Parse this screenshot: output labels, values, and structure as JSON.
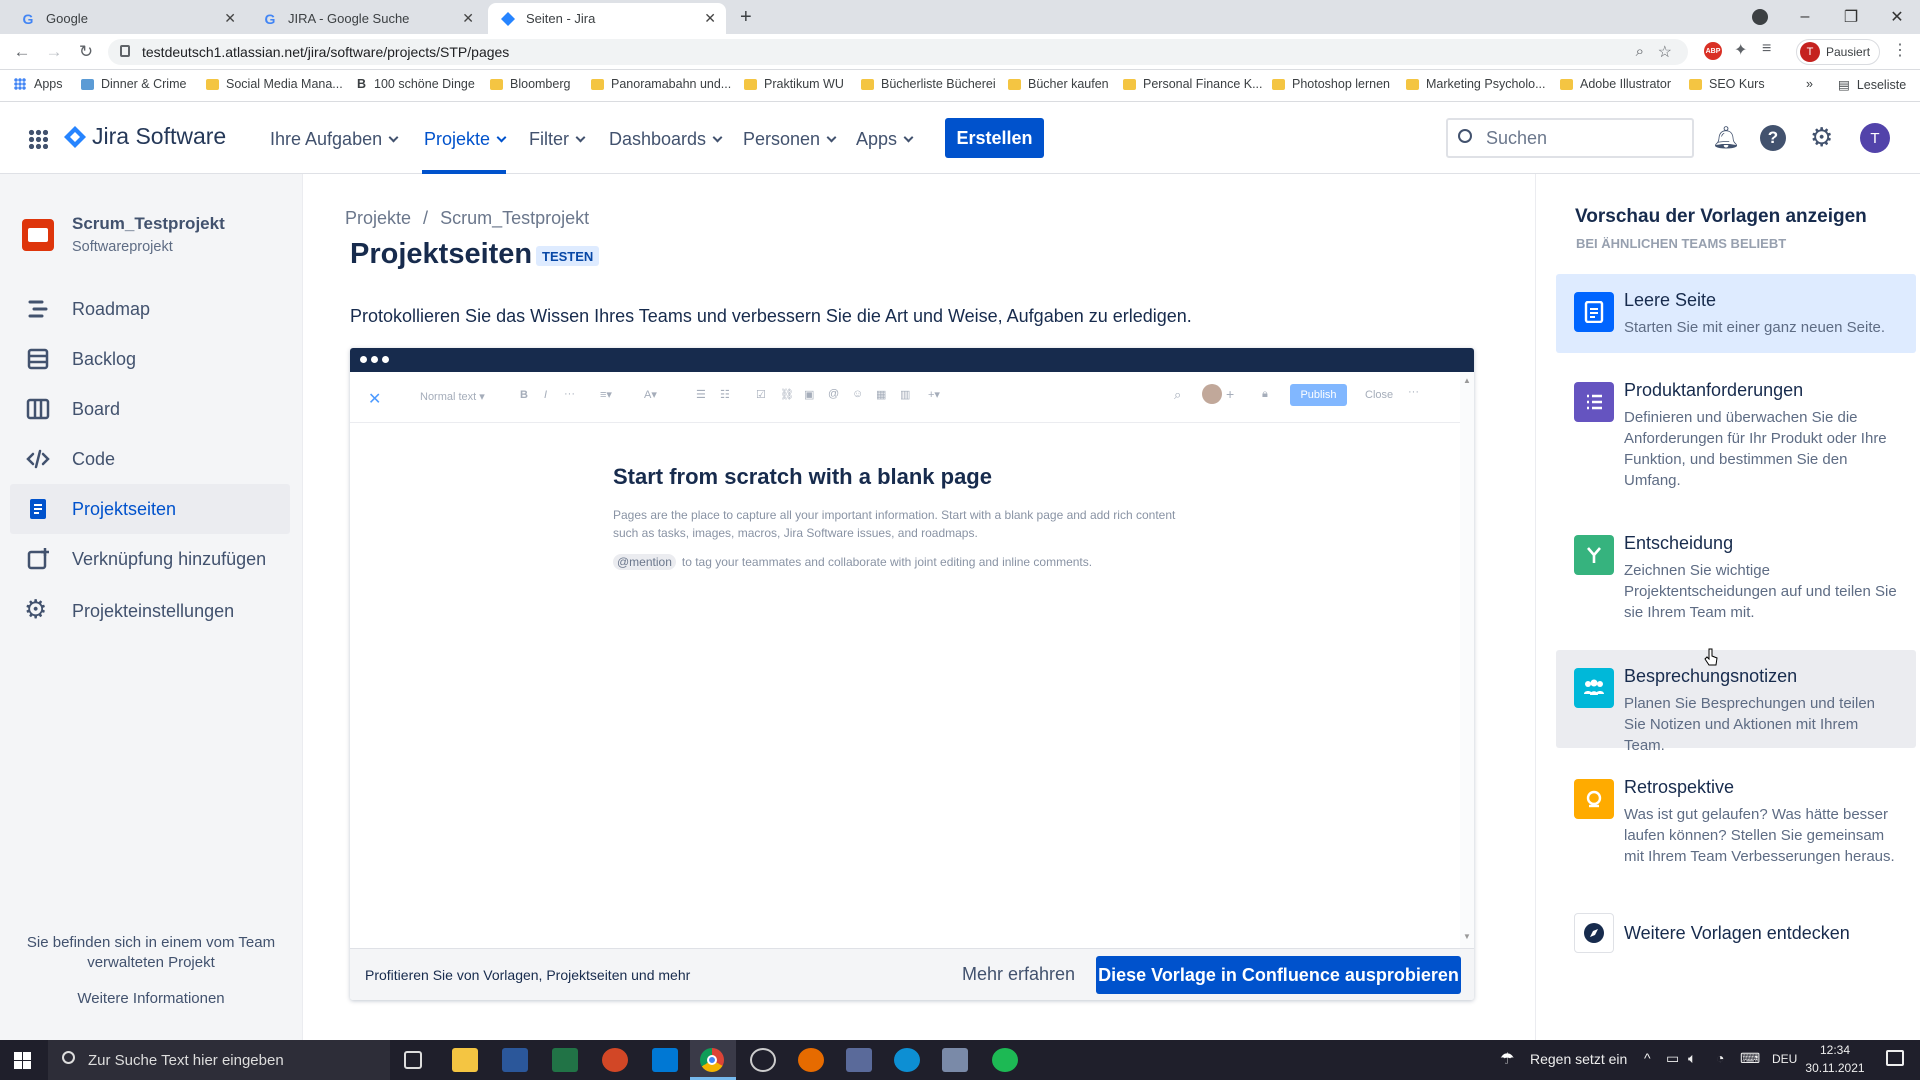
{
  "browser": {
    "tabs": [
      {
        "title": "Google",
        "icon": "google-icon"
      },
      {
        "title": "JIRA - Google Suche",
        "icon": "google-icon"
      },
      {
        "title": "Seiten - Jira",
        "icon": "jira-icon"
      }
    ],
    "url": "testdeutsch1.atlassian.net/jira/software/projects/STP/pages",
    "profile_status": "Pausiert",
    "profile_initial": "T",
    "bookmarks": [
      "Apps",
      "Dinner & Crime",
      "Social Media Mana...",
      "100 schöne Dinge",
      "Bloomberg",
      "Panoramabahn und...",
      "Praktikum WU",
      "Bücherliste Bücherei",
      "Bücher kaufen",
      "Personal Finance K...",
      "Photoshop lernen",
      "Marketing Psycholo...",
      "Adobe Illustrator",
      "SEO Kurs"
    ],
    "reading_list": "Leseliste"
  },
  "jira": {
    "product": "Jira Software",
    "menu": [
      "Ihre Aufgaben",
      "Projekte",
      "Filter",
      "Dashboards",
      "Personen",
      "Apps"
    ],
    "create_label": "Erstellen",
    "search_placeholder": "Suchen",
    "avatar_initial": "T",
    "accent": "#0052cc"
  },
  "sidebar": {
    "project_name": "Scrum_Testprojekt",
    "project_type": "Softwareprojekt",
    "items": [
      "Roadmap",
      "Backlog",
      "Board",
      "Code",
      "Projektseiten",
      "Verknüpfung hinzufügen",
      "Projekteinstellungen"
    ],
    "selected": "Projektseiten",
    "footer_text": "Sie befinden sich in einem vom Team verwalteten Projekt",
    "footer_link": "Weitere Informationen"
  },
  "main": {
    "breadcrumb": [
      "Projekte",
      "Scrum_Testprojekt"
    ],
    "title": "Projektseiten",
    "badge": "TESTEN",
    "intro": "Protokollieren Sie das Wissen Ihres Teams und verbessern Sie die Art und Weise, Aufgaben zu erledigen.",
    "editor": {
      "style_select": "Normal text",
      "publish": "Publish",
      "close": "Close",
      "heading": "Start from scratch with a blank page",
      "body": "Pages are the place to capture all your important information. Start with a blank page and add rich content such as tasks, images, macros, Jira Software issues, and roadmaps.",
      "mention_chip": "@mention",
      "mention_text": "to tag your teammates and collaborate with joint editing and inline comments."
    },
    "footer_text": "Profitieren Sie von Vorlagen, Projektseiten und mehr",
    "learn_more": "Mehr erfahren",
    "try_button": "Diese Vorlage in Confluence ausprobieren"
  },
  "templates": {
    "heading": "Vorschau der Vorlagen anzeigen",
    "subheading": "BEI ÄHNLICHEN TEAMS BELIEBT",
    "items": [
      {
        "title": "Leere Seite",
        "desc": "Starten Sie mit einer ganz neuen Seite.",
        "color": "#0065ff",
        "icon": "page-icon"
      },
      {
        "title": "Produktanforderungen",
        "desc": "Definieren und überwachen Sie die Anforderungen für Ihr Produkt oder Ihre Funktion, und bestimmen Sie den Umfang.",
        "color": "#6554c0",
        "icon": "list-icon"
      },
      {
        "title": "Entscheidung",
        "desc": "Zeichnen Sie wichtige Projektentscheidungen auf und teilen Sie sie Ihrem Team mit.",
        "color": "#36b37e",
        "icon": "decision-icon"
      },
      {
        "title": "Besprechungsnotizen",
        "desc": "Planen Sie Besprechungen und teilen Sie Notizen und Aktionen mit Ihrem Team.",
        "color": "#00b8d9",
        "icon": "team-icon"
      },
      {
        "title": "Retrospektive",
        "desc": "Was ist gut gelaufen? Was hätte besser laufen können? Stellen Sie gemeinsam mit Ihrem Team Verbesserungen heraus.",
        "color": "#ffab00",
        "icon": "retro-icon"
      }
    ],
    "more": "Weitere Vorlagen entdecken"
  },
  "taskbar": {
    "search_placeholder": "Zur Suche Text hier eingeben",
    "weather": "Regen setzt ein",
    "lang": "DEU",
    "time": "12:34",
    "date": "30.11.2021"
  }
}
